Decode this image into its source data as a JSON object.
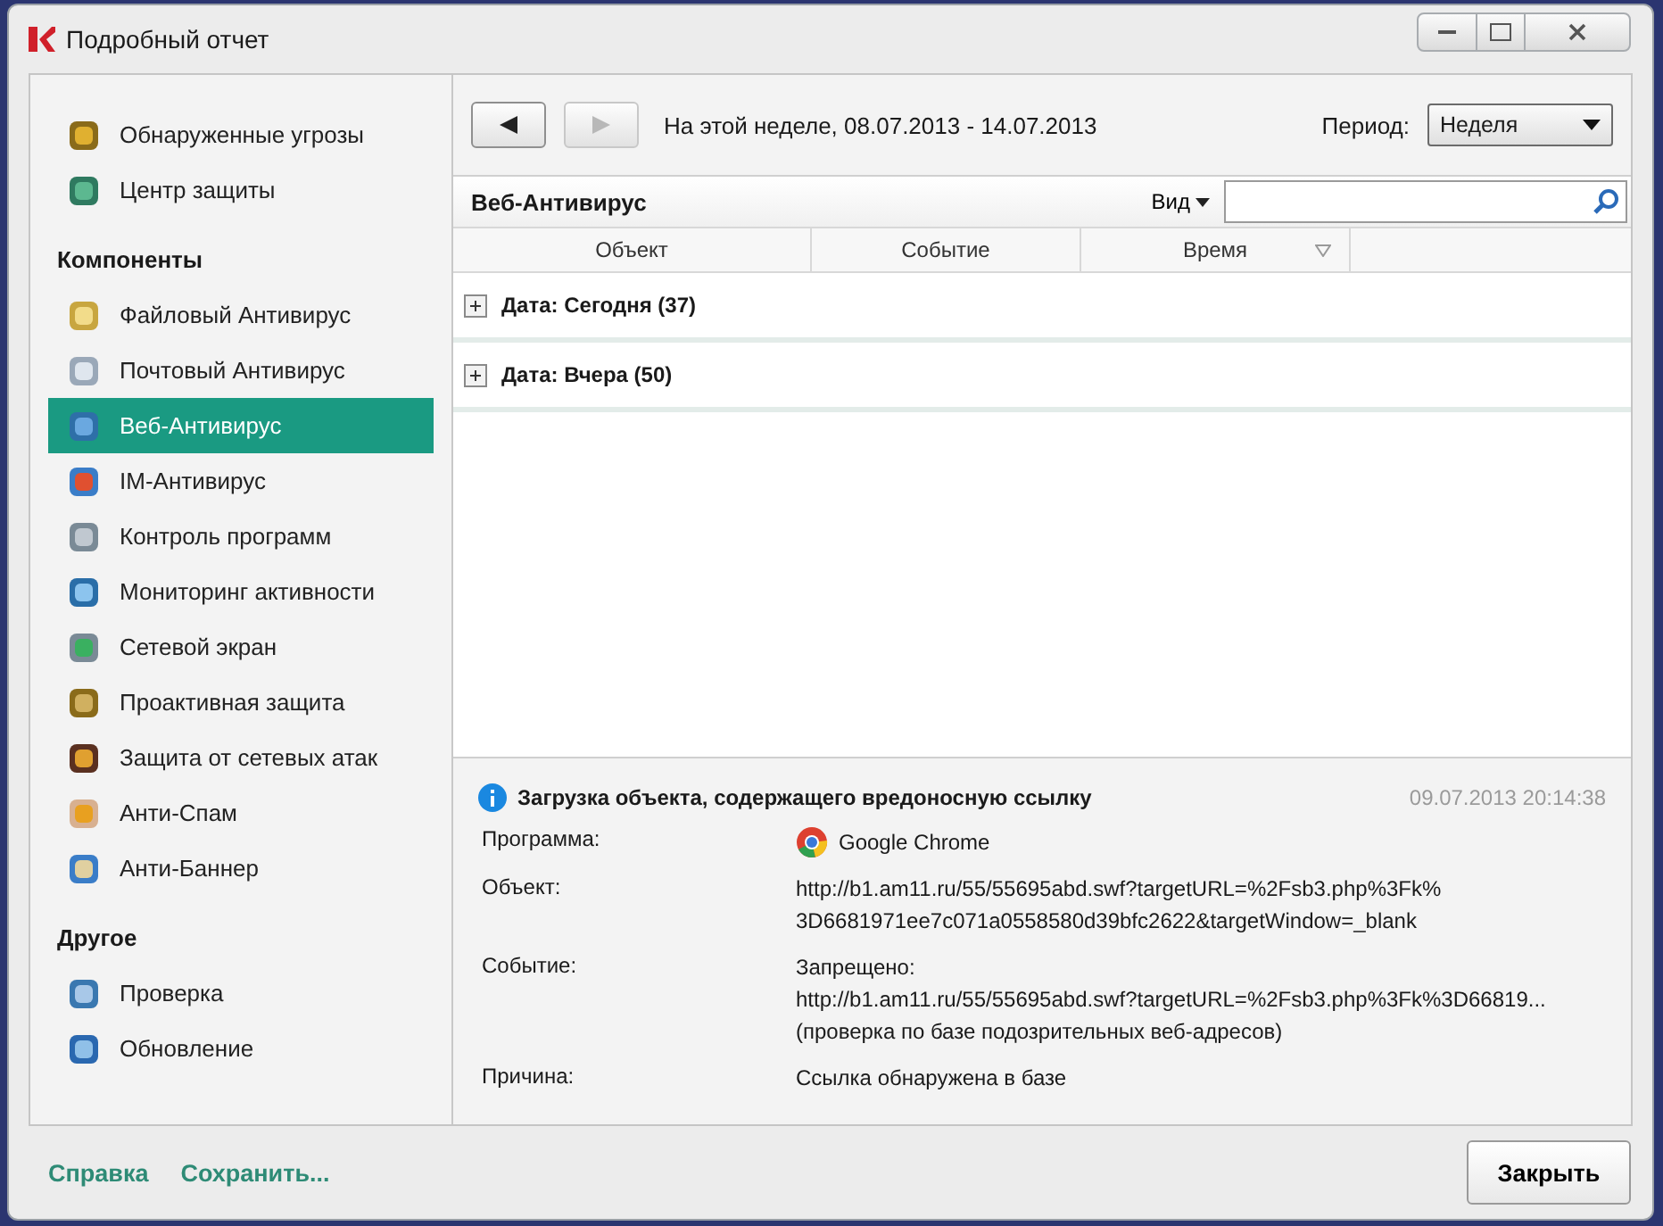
{
  "window": {
    "title": "Подробный отчет"
  },
  "sidebar": {
    "top_items": [
      {
        "label": "Обнаруженные угрозы",
        "selected": false
      },
      {
        "label": "Центр защиты",
        "selected": false
      }
    ],
    "sections": [
      {
        "heading": "Компоненты",
        "items": [
          {
            "label": "Файловый Антивирус",
            "selected": false
          },
          {
            "label": "Почтовый Антивирус",
            "selected": false
          },
          {
            "label": "Веб-Антивирус",
            "selected": true
          },
          {
            "label": "IM-Антивирус",
            "selected": false
          },
          {
            "label": "Контроль программ",
            "selected": false
          },
          {
            "label": "Мониторинг активности",
            "selected": false
          },
          {
            "label": "Сетевой экран",
            "selected": false
          },
          {
            "label": "Проактивная защита",
            "selected": false
          },
          {
            "label": "Защита от сетевых атак",
            "selected": false
          },
          {
            "label": "Анти-Спам",
            "selected": false
          },
          {
            "label": "Анти-Баннер",
            "selected": false
          }
        ]
      },
      {
        "heading": "Другое",
        "items": [
          {
            "label": "Проверка",
            "selected": false
          },
          {
            "label": "Обновление",
            "selected": false
          }
        ]
      }
    ]
  },
  "toolbar": {
    "back_disabled": false,
    "forward_disabled": true,
    "range": "На этой неделе, 08.07.2013 - 14.07.2013",
    "period_label": "Период:",
    "period_value": "Неделя"
  },
  "panel": {
    "title": "Веб-Антивирус",
    "view_label": "Вид"
  },
  "table": {
    "columns": [
      "Объект",
      "Событие",
      "Время"
    ],
    "groups": [
      {
        "label": "Дата: Сегодня (37)",
        "expanded": false
      },
      {
        "label": "Дата: Вчера (50)",
        "expanded": false
      }
    ]
  },
  "details": {
    "title": "Загрузка объекта, содержащего вредоносную ссылку",
    "timestamp": "09.07.2013 20:14:38",
    "fields": [
      {
        "label": "Программа:",
        "kind": "app",
        "lines": [
          "Google Chrome"
        ]
      },
      {
        "label": "Объект:",
        "kind": "text",
        "lines": [
          "http://b1.am11.ru/55/55695abd.swf?targetURL=%2Fsb3.php%3Fk%",
          "3D6681971ee7c071a0558580d39bfc2622&targetWindow=_blank"
        ]
      },
      {
        "label": "Событие:",
        "kind": "text",
        "lines": [
          "Запрещено:",
          "http://b1.am11.ru/55/55695abd.swf?targetURL=%2Fsb3.php%3Fk%3D66819...",
          "(проверка по базе подозрительных веб-адресов)"
        ]
      },
      {
        "label": "Причина:",
        "kind": "text",
        "lines": [
          "Ссылка обнаружена в базе"
        ]
      }
    ]
  },
  "footer": {
    "links": [
      "Справка",
      "Сохранить..."
    ],
    "close_button": "Закрыть"
  }
}
